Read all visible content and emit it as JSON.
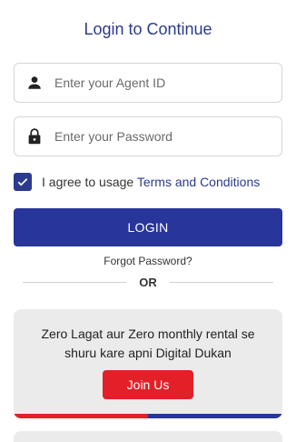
{
  "header": {
    "title": "Login to Continue"
  },
  "form": {
    "agent_id": {
      "placeholder": "Enter your Agent ID",
      "value": "",
      "icon": "person-icon"
    },
    "password": {
      "placeholder": "Enter your Password",
      "value": "",
      "icon": "lock-icon"
    },
    "agree": {
      "checked": true,
      "prefix": "I agree to usage ",
      "link_label": "Terms and Conditions"
    },
    "login_label": "LOGIN",
    "forgot_label": "Forgot Password?",
    "or_label": "OR"
  },
  "promo": {
    "line1": "Zero Lagat aur Zero monthly rental se",
    "line2": "shuru kare apni Digital Dukan",
    "join_label": "Join Us"
  },
  "colors": {
    "brand_blue": "#28359a",
    "title_blue": "#2c3a8c",
    "accent_red": "#e32028",
    "card_gray": "#ebebeb"
  }
}
